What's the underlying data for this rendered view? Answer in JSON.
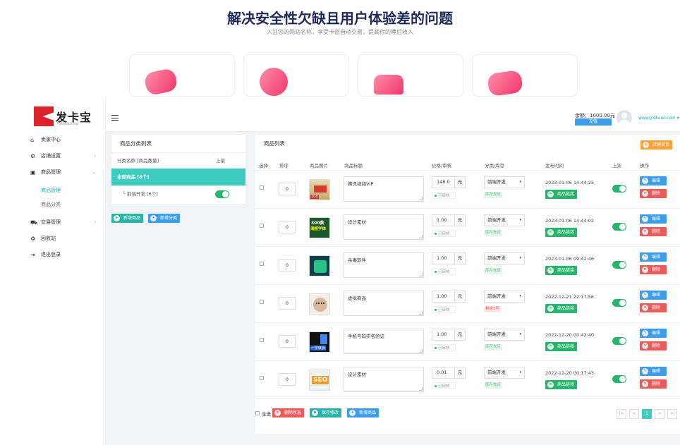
{
  "hero": {
    "title": "解决安全性欠缺且用户体验差的问题",
    "subtitle": "入驻您的网站名称，享受卡密自动交易，提高你的睡后收入"
  },
  "brand": {
    "name": "发卡宝",
    "sub": "Fakabao.top"
  },
  "sidebar": {
    "items": [
      {
        "label": "卖家中心",
        "icon": "home-icon"
      },
      {
        "label": "店铺设置",
        "icon": "gear-icon"
      },
      {
        "label": "商品管理",
        "icon": "bag-icon"
      },
      {
        "label": "交易管理",
        "icon": "cart-icon"
      },
      {
        "label": "回收站",
        "icon": "recycle-icon"
      },
      {
        "label": "退出登录",
        "icon": "logout-icon"
      }
    ],
    "sub_items": [
      {
        "label": "商品管理",
        "active": true
      },
      {
        "label": "商品分类",
        "active": false
      }
    ]
  },
  "topbar": {
    "balance": "余额：1000.00元",
    "recharge": "充值",
    "email": "www@dkewl.com"
  },
  "categories": {
    "title": "商品分类列表",
    "col_name": "分类名称 [商品数量]",
    "col_status": "上架",
    "all": "全部商品 [6个]",
    "rows": [
      {
        "label": "└ 前端开发 [6个]"
      }
    ],
    "add_product": "新增商品",
    "add_category": "新增分类"
  },
  "products": {
    "title": "商品列表",
    "shop_home": "店铺首页",
    "headers": [
      "选择",
      "排序",
      "商品图片",
      "商品标题",
      "价格/审核",
      "分类/库存",
      "发布时间",
      "上架",
      "操作"
    ],
    "price_unit": "元",
    "audit_label": "已审核",
    "edit_label": "编辑",
    "delete_label": "删除",
    "link_label": "商品链接",
    "rows": [
      {
        "sort": "0",
        "title": "腾讯视频VIP",
        "price": "148.0",
        "category": "前端开发",
        "stock": "库存充足",
        "stock_ok": true,
        "date": "2023-01-06 14:44:25"
      },
      {
        "sort": "0",
        "title": "设计素材",
        "price": "1.00",
        "category": "前端开发",
        "stock": "库存充足",
        "stock_ok": true,
        "date": "2023-01-06 14:44:02"
      },
      {
        "sort": "0",
        "title": "杀毒软件",
        "price": "1.00",
        "category": "前端开发",
        "stock": "库存充足",
        "stock_ok": true,
        "date": "2023-01-06 09:42:46"
      },
      {
        "sort": "0",
        "title": "虚拟商品",
        "price": "1.00",
        "category": "前端开发",
        "stock": "剩余5件",
        "stock_ok": false,
        "date": "2022-12-21 22:17:56"
      },
      {
        "sort": "0",
        "title": "手机号码实名验证",
        "price": "1.00",
        "category": "前端开发",
        "stock": "库存充足",
        "stock_ok": true,
        "date": "2022-12-20 00:42:40"
      },
      {
        "sort": "0",
        "title": "设计素材",
        "price": "0.01",
        "category": "前端开发",
        "stock": "库存充足",
        "stock_ok": true,
        "date": "2022-12-20 00:17:43"
      }
    ],
    "select_all": "全选",
    "delete_selected": "删除所选",
    "save_changes": "保存修改",
    "add_product": "新增商品",
    "pager": [
      "|<",
      "<",
      "1",
      ">",
      ">|"
    ]
  },
  "colors": {
    "accent": "#3ecbc0",
    "primary": "#3d9de8",
    "danger": "#ec5b5b",
    "success": "#25b56b",
    "warning": "#f7a23a"
  }
}
